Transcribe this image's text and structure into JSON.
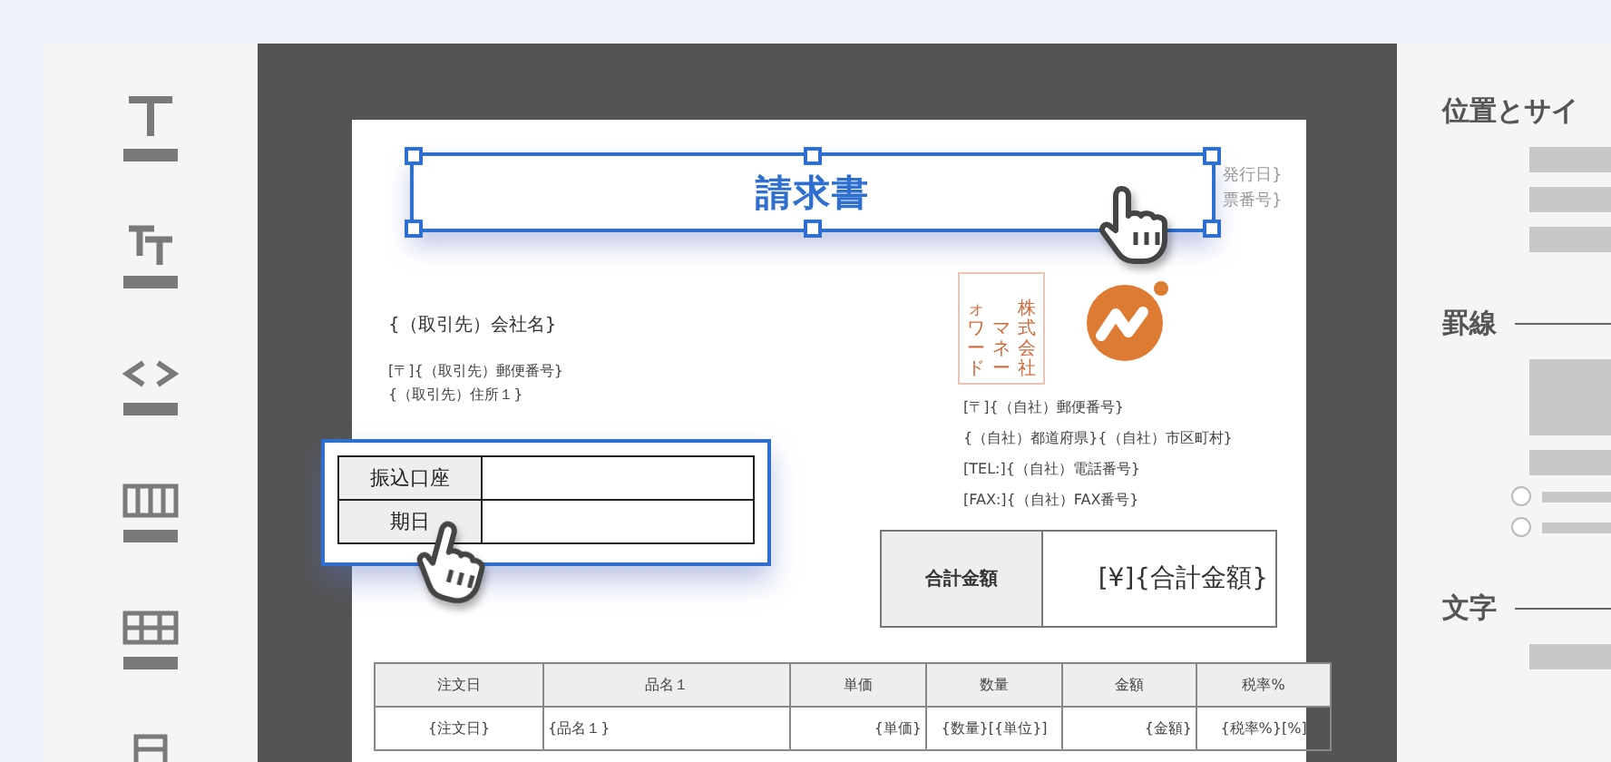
{
  "document": {
    "title_block": {
      "text": "請求書",
      "selected": true
    },
    "issue_info": [
      "発行日}",
      "票番号}"
    ],
    "client": {
      "company": "{（取引先）会社名}",
      "lines": [
        "[〒]{（取引先）郵便番号}",
        "{（取引先）住所１}"
      ]
    },
    "stamp": {
      "columns": [
        "ォワード",
        "マネー",
        "株式会社"
      ]
    },
    "issuer_lines": [
      "[〒]{（自社）郵便番号}",
      "{（自社）都道府県}{（自社）市区町村}",
      "[TEL:]{（自社）電話番号}",
      "[FAX:]{（自社）FAX番号}"
    ],
    "bank_table": {
      "selected": true,
      "rows": [
        "振込口座",
        "期日"
      ]
    },
    "total": {
      "label": "合計金額",
      "value": "[¥]{合計金額}"
    },
    "items_table": {
      "columns": [
        "注文日",
        "品名１",
        "単価",
        "数量",
        "金額",
        "税率%"
      ],
      "rows": [
        [
          "{注文日}",
          "{品名１}",
          "{単価}",
          "{数量}[{単位}]",
          "{金額}",
          "{税率%}[%]"
        ]
      ]
    }
  },
  "properties_panel": {
    "sections": [
      {
        "kind": "size",
        "title": "位置とサイ"
      },
      {
        "kind": "border",
        "title": "罫線",
        "options": [
          {
            "selected": false
          },
          {
            "selected": false
          }
        ]
      },
      {
        "kind": "text",
        "title": "文字"
      }
    ]
  }
}
